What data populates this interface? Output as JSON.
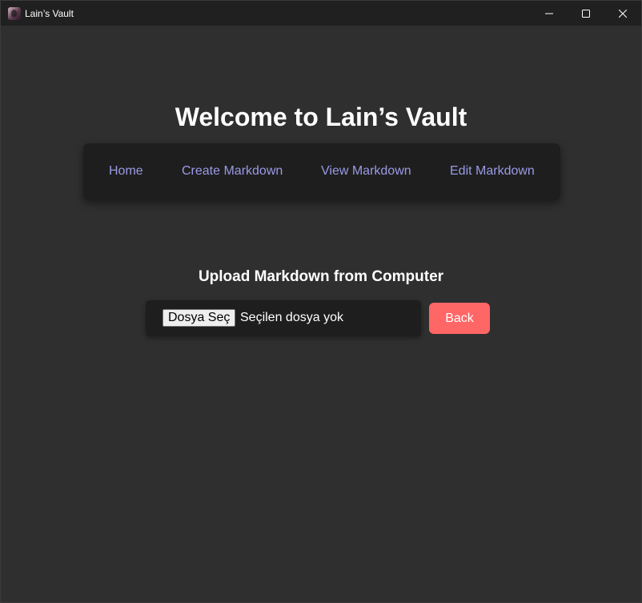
{
  "window": {
    "title": "Lain’s Vault",
    "icon": "lain-avatar-icon"
  },
  "page": {
    "heading": "Welcome to Lain’s Vault"
  },
  "nav": {
    "items": [
      {
        "label": "Home"
      },
      {
        "label": "Create Markdown"
      },
      {
        "label": "View Markdown"
      },
      {
        "label": "Edit Markdown"
      }
    ]
  },
  "upload": {
    "title": "Upload Markdown from Computer",
    "choose_file_label": "Dosya Seç",
    "file_status": "Seçilen dosya yok"
  },
  "actions": {
    "back_label": "Back"
  },
  "colors": {
    "background": "#2f2f2f",
    "panel": "#1e1e1e",
    "link": "#9a9ae6",
    "back_button": "#ff6666"
  }
}
